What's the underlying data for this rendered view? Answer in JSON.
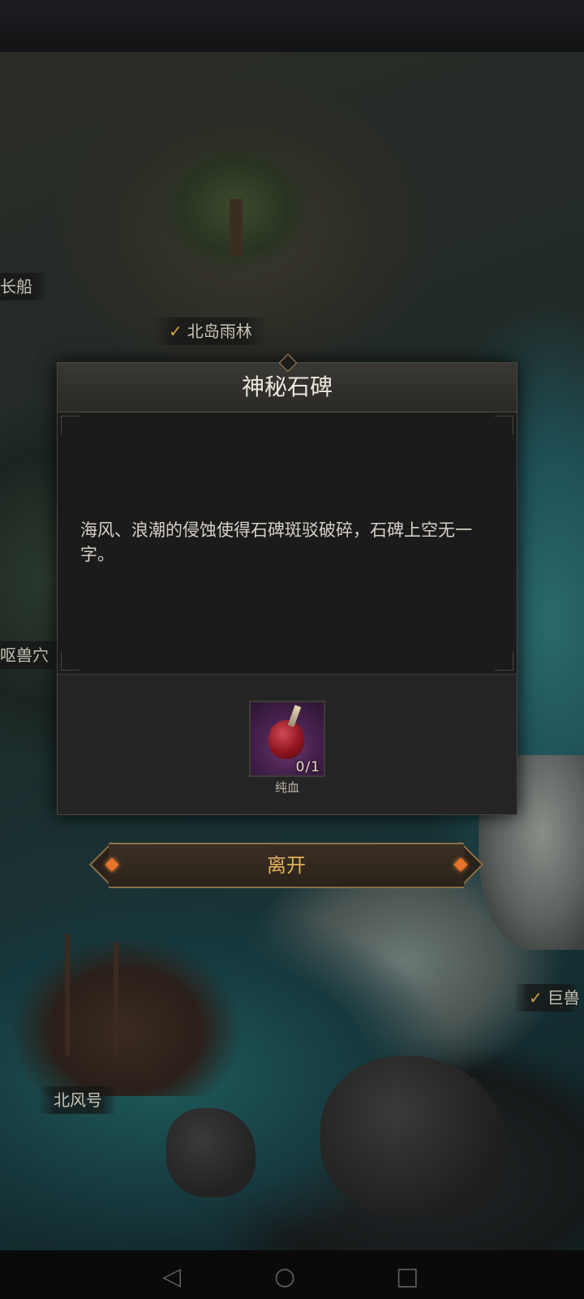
{
  "map": {
    "labels": {
      "north_island_rainforest": "北岛雨林",
      "longship": "长船",
      "beast_cave": "呕兽穴",
      "giant_beast": "巨兽",
      "north_wind": "北风号"
    }
  },
  "dialog": {
    "title": "神秘石碑",
    "description": "海风、浪潮的侵蚀使得石碑斑驳破碎，石碑上空无一字。",
    "item": {
      "name": "纯血",
      "count": "0/1",
      "icon": "blood-potion-icon"
    }
  },
  "buttons": {
    "leave": "离开"
  },
  "colors": {
    "accent": "#e1b05a",
    "check": "#d4a440",
    "gem": "#e8742a"
  }
}
